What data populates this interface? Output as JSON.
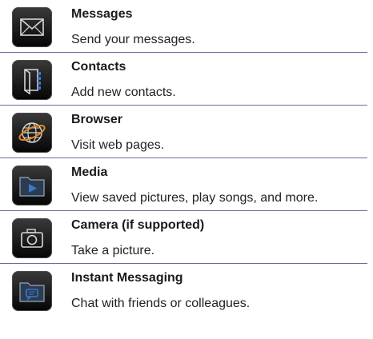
{
  "items": [
    {
      "title": "Messages",
      "description": "Send your messages.",
      "icon": "envelope-icon"
    },
    {
      "title": "Contacts",
      "description": "Add new contacts.",
      "icon": "address-book-icon"
    },
    {
      "title": "Browser",
      "description": "Visit web pages.",
      "icon": "globe-icon"
    },
    {
      "title": "Media",
      "description": "View saved pictures, play songs, and more.",
      "icon": "media-folder-icon"
    },
    {
      "title": "Camera (if supported)",
      "description": "Take a picture.",
      "icon": "camera-icon"
    },
    {
      "title": "Instant Messaging",
      "description": "Chat with friends or colleagues.",
      "icon": "chat-folder-icon"
    }
  ],
  "colors": {
    "divider": "#6a6aa8",
    "accent_blue": "#3a78c8",
    "accent_orange": "#e38a1e"
  }
}
